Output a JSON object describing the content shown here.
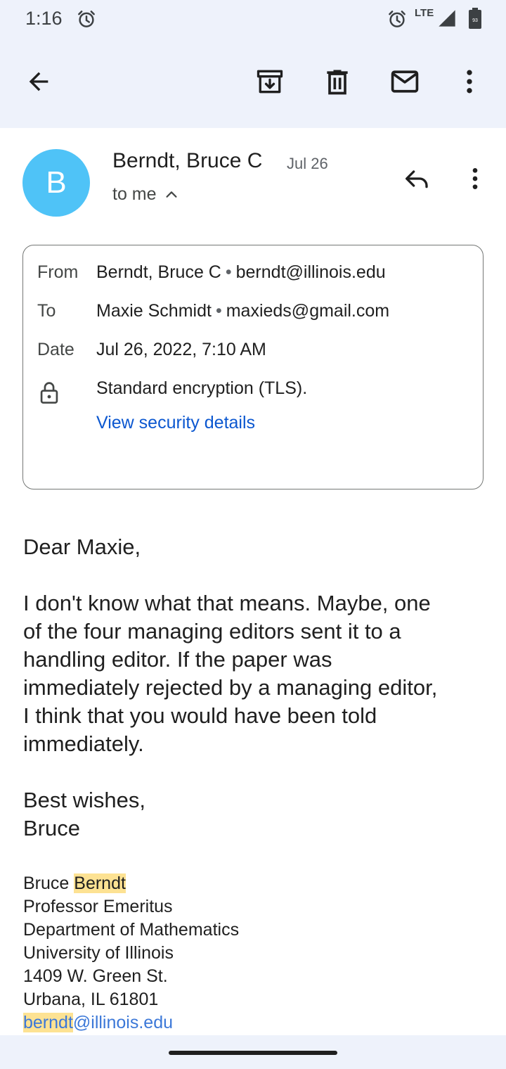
{
  "status_bar": {
    "time": "1:16",
    "network": "LTE",
    "battery_level": "93"
  },
  "sender": {
    "initial": "B",
    "name": "Berndt, Bruce C",
    "date": "Jul 26",
    "recipient_summary": "to me"
  },
  "details": {
    "from_label": "From",
    "from_name": "Berndt, Bruce C",
    "from_email": "berndt@illinois.edu",
    "to_label": "To",
    "to_name": "Maxie Schmidt",
    "to_email": "maxieds@gmail.com",
    "date_label": "Date",
    "date_value": "Jul 26, 2022, 7:10 AM",
    "encryption": "Standard encryption (TLS).",
    "security_link": "View security details"
  },
  "body": {
    "greeting": "Dear Maxie,",
    "paragraph_lines": [
      "I don't know what that means.  Maybe, one",
      "of the four managing editors sent it to a",
      "handling editor.  If the paper was",
      "immediately rejected by a managing editor,",
      "I think that you would have been told",
      "immediately."
    ],
    "closing": "Best wishes,",
    "closing_name": "Bruce"
  },
  "signature": {
    "first_name": "Bruce",
    "last_name_highlight": "Berndt",
    "title": "Professor Emeritus",
    "department": "Department of Mathematics",
    "university": "University of Illinois",
    "street": "1409 W. Green St.",
    "city": "Urbana, IL 61801",
    "email_user_highlight": "berndt",
    "email_domain": "@illinois.edu"
  },
  "colors": {
    "header_bg": "#eef2fb",
    "avatar": "#4fc3f7",
    "link": "#0b57d0",
    "highlight": "#fde293"
  }
}
